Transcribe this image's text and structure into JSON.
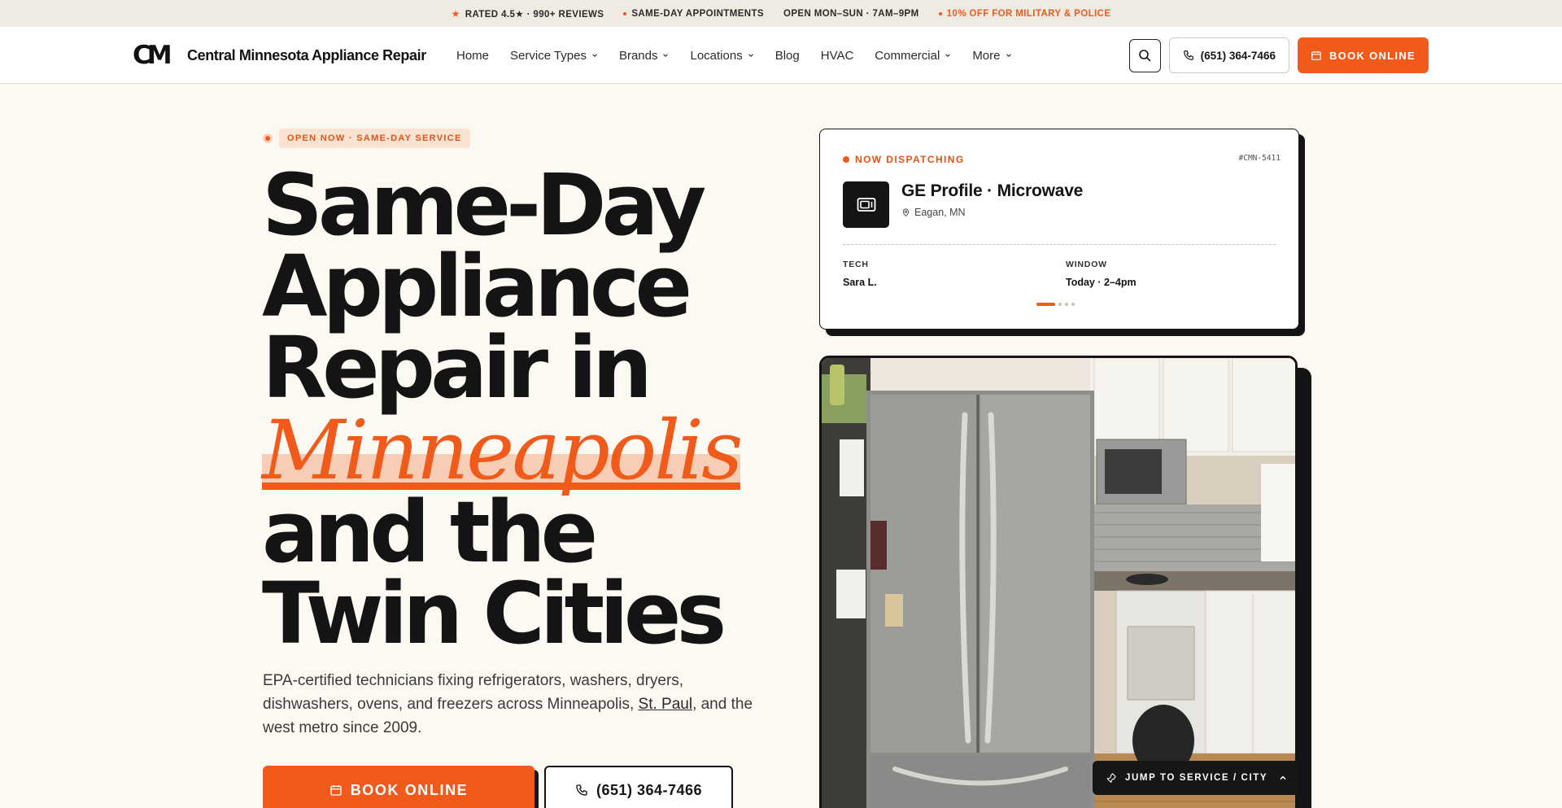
{
  "topbar": {
    "rating": "RATED 4.5★ · 990+ REVIEWS",
    "same_day": "SAME-DAY APPOINTMENTS",
    "hours": "OPEN MON–SUN · 7AM–9PM",
    "discount": "10% OFF FOR MILITARY & POLICE",
    "accent_color": "#f05a1a"
  },
  "nav": {
    "logo_mark": "CM",
    "brand": "Central Minnesota Appliance Repair",
    "links": [
      {
        "label": "Home"
      },
      {
        "label": "Service Types"
      },
      {
        "label": "Brands"
      },
      {
        "label": "Locations"
      },
      {
        "label": "Blog"
      },
      {
        "label": "HVAC"
      },
      {
        "label": "Commercial"
      },
      {
        "label": "More"
      }
    ],
    "phone": "(651) 364-7466",
    "book": "BOOK ONLINE"
  },
  "hero": {
    "badge": "OPEN NOW · SAME-DAY SERVICE",
    "headline_l1": "Same-Day",
    "headline_l2": "Appliance",
    "headline_l3": "Repair in",
    "headline_city": "Minneapolis",
    "headline_l5": "and the",
    "headline_l6": "Twin Cities",
    "sub_part1": "EPA-certified technicians fixing refrigerators, washers, dryers, dishwashers, ovens, and freezers across Minneapolis, ",
    "sub_link": "St. Paul",
    "sub_part2": ", and the west metro since 2009.",
    "cta_book": "BOOK ONLINE",
    "cta_phone": "(651) 364-7466"
  },
  "dispatch": {
    "status": "NOW DISPATCHING",
    "ticket": "#CMN-5411",
    "appliance": "GE Profile · Microwave",
    "location": "Eagan, MN",
    "tech_label": "TECH",
    "tech_value": "Sara L.",
    "window_label": "WINDOW",
    "window_value": "Today · 2–4pm"
  },
  "jump": {
    "label": "JUMP TO SERVICE / CITY"
  }
}
